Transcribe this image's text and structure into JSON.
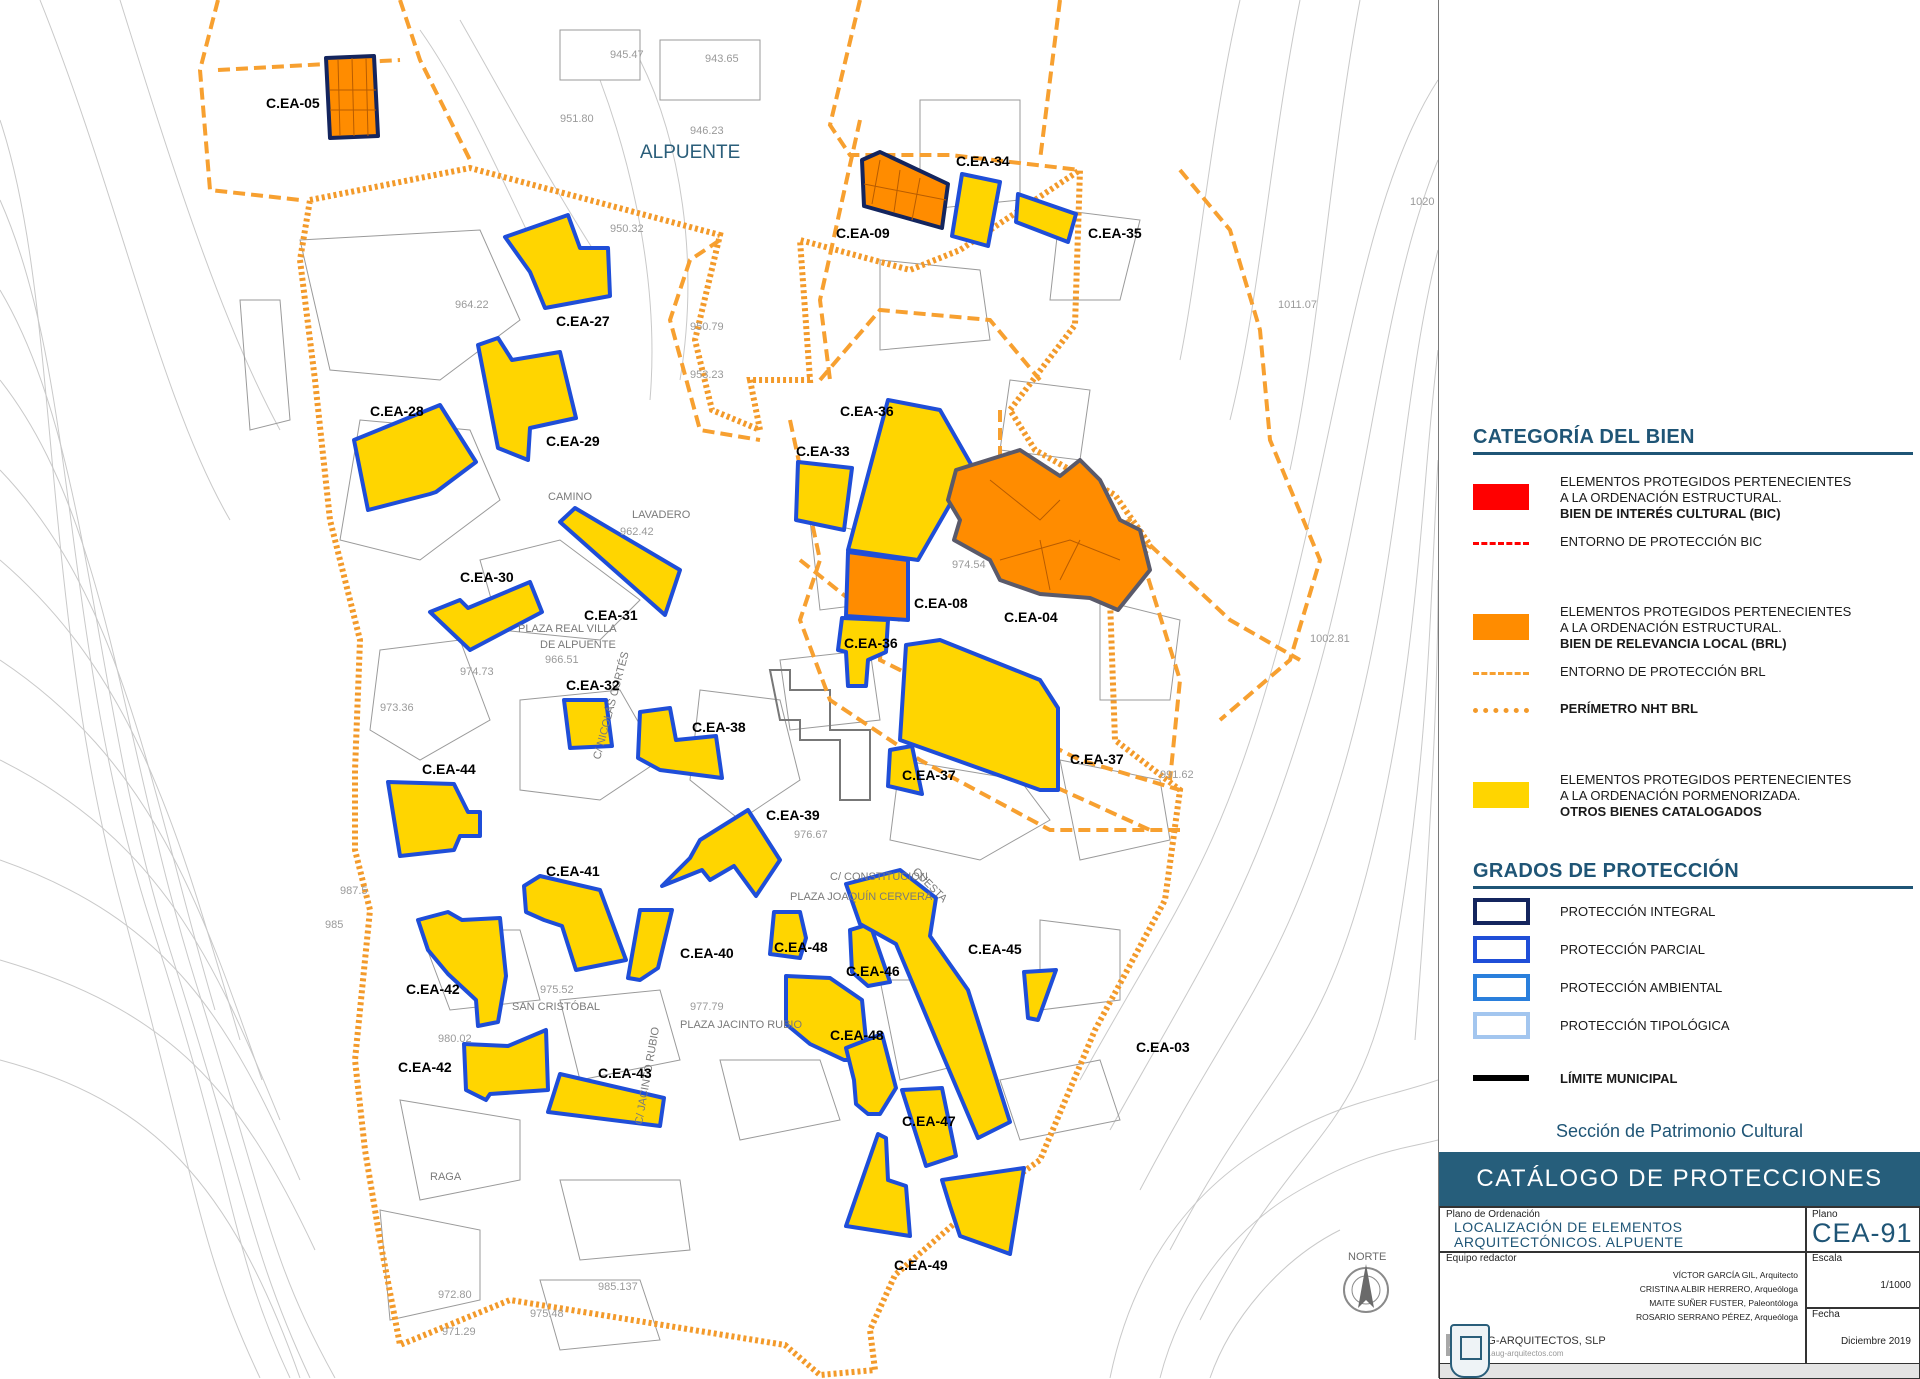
{
  "map": {
    "town_label": "ALPUENTE",
    "parcel_labels": [
      "C.EA-05",
      "C.EA-09",
      "C.EA-34",
      "C.EA-35",
      "C.EA-27",
      "C.EA-28",
      "C.EA-29",
      "C.EA-30",
      "C.EA-31",
      "C.EA-32",
      "C.EA-33",
      "C.EA-36",
      "C.EA-36",
      "C.EA-08",
      "C.EA-04",
      "C.EA-37",
      "C.EA-37",
      "C.EA-38",
      "C.EA-39",
      "C.EA-44",
      "C.EA-41",
      "C.EA-40",
      "C.EA-48",
      "C.EA-46",
      "C.EA-48",
      "C.EA-45",
      "C.EA-42",
      "C.EA-42",
      "C.EA-43",
      "C.EA-47",
      "C.EA-49",
      "C.EA-03"
    ],
    "street_labels": [
      "CAMINO",
      "LAVADERO",
      "PLAZA REAL VILLA",
      "DE ALPUENTE",
      "C/ NICOLÁS CORTÉS",
      "PLAZA JOAQUÍN CERVERA",
      "C/ CONSTITUCIÓN",
      "PLAZA JACINTO RUBIO",
      "C/ JACINTO RUBIO",
      "SAN CRISTÓBAL",
      "RAGA",
      "CUESTA"
    ],
    "contour_labels": [
      "945.47",
      "943.65",
      "951.80",
      "946.23",
      "950.32",
      "950.79",
      "953.23",
      "964.22",
      "962.42",
      "966.51",
      "974.73",
      "973.36",
      "976.67",
      "975.52",
      "977.79",
      "980.02",
      "974.54",
      "991.62",
      "1011.07",
      "1020",
      "1002.81",
      "987.5",
      "985",
      "972.80",
      "971.29",
      "975.48",
      "985.137"
    ],
    "north_label": "NORTE"
  },
  "legend": {
    "category_title": "CATEGORÍA DEL BIEN",
    "items": [
      {
        "l1": "ELEMENTOS PROTEGIDOS PERTENECIENTES",
        "l2": "A LA ORDENACIÓN ESTRUCTURAL.",
        "l3": "BIEN DE INTERÉS CULTURAL (BIC)",
        "color": "#ff0000"
      },
      {
        "label": "ENTORNO DE PROTECCIÓN BIC",
        "color": "#ff0000"
      },
      {
        "l1": "ELEMENTOS PROTEGIDOS PERTENECIENTES",
        "l2": "A LA ORDENACIÓN ESTRUCTURAL.",
        "l3": "BIEN DE RELEVANCIA LOCAL (BRL)",
        "color": "#ff8c00"
      },
      {
        "label": "ENTORNO DE PROTECCIÓN BRL",
        "color": "#f7a030"
      },
      {
        "label": "PERÍMETRO NHT BRL",
        "color": "#f7a030"
      },
      {
        "l1": "ELEMENTOS PROTEGIDOS PERTENECIENTES",
        "l2": "A LA ORDENACIÓN PORMENORIZADA.",
        "l3": "OTROS BIENES CATALOGADOS",
        "color": "#ffd500"
      }
    ],
    "grades_title": "GRADOS DE PROTECCIÓN",
    "grades": [
      {
        "label": "PROTECCIÓN INTEGRAL",
        "color": "#14255e"
      },
      {
        "label": "PROTECCIÓN PARCIAL",
        "color": "#1f4ed8"
      },
      {
        "label": "PROTECCIÓN AMBIENTAL",
        "color": "#2a7fdc"
      },
      {
        "label": "PROTECCIÓN TIPOLÓGICA",
        "color": "#a3c6ef"
      }
    ],
    "limit": {
      "label": "LÍMITE MUNICIPAL",
      "color": "#000000"
    }
  },
  "title_block": {
    "section": "Sección de Patrimonio Cultural",
    "catalog": "CATÁLOGO DE PROTECCIONES",
    "plan_type_label": "Plano de Ordenación",
    "plan_title_1": "LOCALIZACIÓN DE ELEMENTOS",
    "plan_title_2": "ARQUITECTÓNICOS. ALPUENTE",
    "plano_label": "Plano",
    "plano_value": "CEA-91",
    "team_label": "Equipo redactor",
    "team": [
      "VÍCTOR GARCÍA GIL, Arquitecto",
      "CRISTINA ALBIR HERRERO, Arqueóloga",
      "MAITE SUÑER FUSTER, Paleontóloga",
      "ROSARIO SERRANO PÉREZ, Arqueóloga"
    ],
    "company": "AUG-ARQUITECTOS, SLP",
    "company_web": "www.aug-arquitectos.com",
    "escala_label": "Escala",
    "escala_value": "1/1000",
    "fecha_label": "Fecha",
    "fecha_value": "Diciembre 2019"
  }
}
